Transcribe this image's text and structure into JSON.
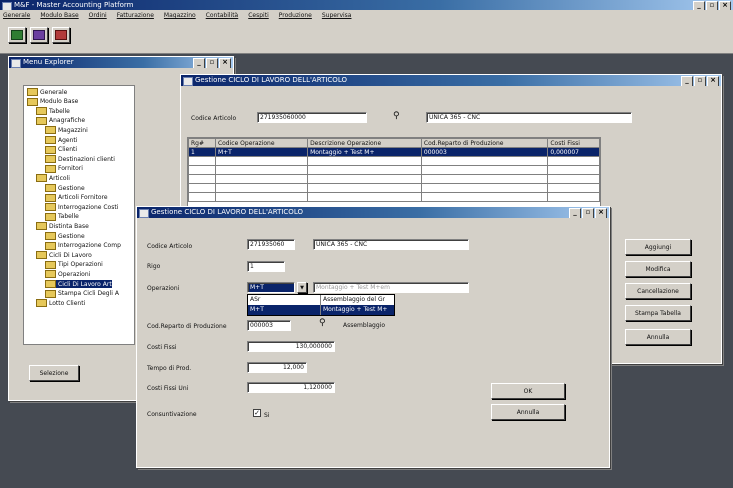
{
  "app": {
    "title": "M&F - Master Accounting Platform",
    "menu": [
      "Generale",
      "Modulo Base",
      "Ordini",
      "Fatturazione",
      "Magazzino",
      "Contabilità",
      "Cespiti",
      "Produzione",
      "Supervisa"
    ]
  },
  "explorer": {
    "title": "Menu Explorer",
    "items": [
      {
        "label": "Generale",
        "level": 0
      },
      {
        "label": "Modulo Base",
        "level": 0
      },
      {
        "label": "Tabelle",
        "level": 1
      },
      {
        "label": "Anagrafiche",
        "level": 1
      },
      {
        "label": "Magazzini",
        "level": 2
      },
      {
        "label": "Agenti",
        "level": 2
      },
      {
        "label": "Clienti",
        "level": 2
      },
      {
        "label": "Destinazioni clienti",
        "level": 2
      },
      {
        "label": "Fornitori",
        "level": 2
      },
      {
        "label": "Articoli",
        "level": 1
      },
      {
        "label": "Gestione",
        "level": 2
      },
      {
        "label": "Articoli Fornitore",
        "level": 2
      },
      {
        "label": "Interrogazione Costi",
        "level": 2
      },
      {
        "label": "Tabelle",
        "level": 2
      },
      {
        "label": "Distinta Base",
        "level": 1
      },
      {
        "label": "Gestione",
        "level": 2
      },
      {
        "label": "Interrogazione Comp",
        "level": 2
      },
      {
        "label": "Cicli Di Lavoro",
        "level": 1
      },
      {
        "label": "Tipi Operazioni",
        "level": 2
      },
      {
        "label": "Operazioni",
        "level": 2
      },
      {
        "label": "Cicli Di Lavoro Art",
        "level": 2
      },
      {
        "label": "Stampa Cicli Degli A",
        "level": 2
      },
      {
        "label": "Lotto Clienti",
        "level": 1
      }
    ],
    "selected_index": 20,
    "select_button": "Selezione"
  },
  "list_window": {
    "title": "Gestione CICLO DI LAVORO DELL'ARTICOLO",
    "codice_label": "Codice Articolo",
    "codice_value": "271935060000",
    "descr_value": "UNICA 365 - CNC",
    "columns": [
      "Rg#",
      "Codice Operazione",
      "Descrizione Operazione",
      "Cod.Reparto di Produzione",
      "Costi Fissi"
    ],
    "rows": [
      [
        "1",
        "M+T",
        "Montaggio + Test M+",
        "000003",
        "0,000007"
      ]
    ],
    "buttons": [
      "Aggiungi",
      "Modifica",
      "Cancellazione",
      "Stampa Tabella",
      "Annulla"
    ]
  },
  "detail_dialog": {
    "title": "Gestione CICLO DI LAVORO DELL'ARTICOLO",
    "labels": {
      "codice": "Codice Articolo",
      "rigo": "Rigo",
      "operazioni": "Operazioni",
      "reparto": "Cod.Reparto di Produzione",
      "costi_fissi": "Costi Fissi",
      "tempo": "Tempo di Prod.",
      "costi_unit": "Costi Fissi Uni",
      "consuntivazione": "Consuntivazione"
    },
    "values": {
      "codice": "271935060",
      "descr": "UNICA 365 - CNC",
      "rigo": "1",
      "operazione": "M+T",
      "operazione_descr": "Montaggio + Test M+em",
      "reparto": "000003",
      "reparto_descr": "Assemblaggio",
      "costi_fissi": "130,000000",
      "tempo": "12,000",
      "costi_unit": "1,120000",
      "consuntivazione": "Si"
    },
    "dropdown_options": [
      {
        "code": "ASr",
        "desc": "Assemblaggio del Gr"
      },
      {
        "code": "M+T",
        "desc": "Montaggio + Test M+"
      }
    ],
    "ok_label": "OK",
    "annulla_label": "Annulla"
  }
}
